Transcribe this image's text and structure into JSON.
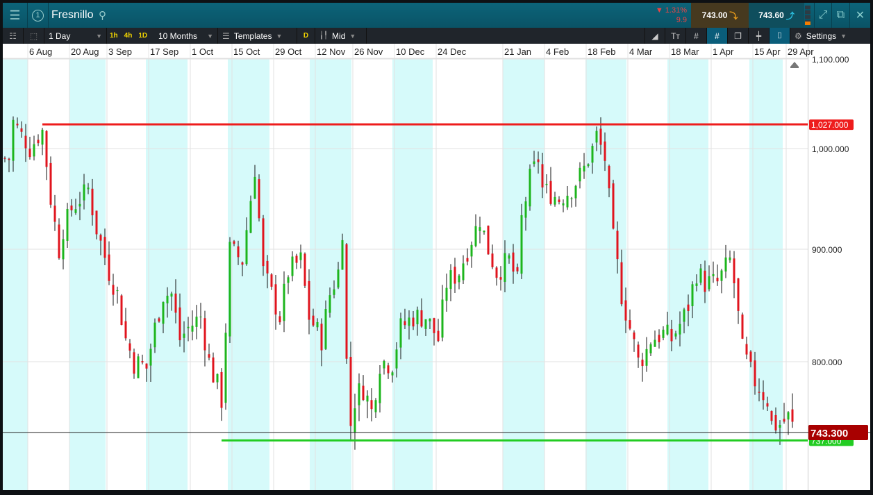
{
  "header": {
    "instrument": "Fresnillo",
    "change_pct": "1.31%",
    "change_abs": "9.9",
    "sell": "743.00",
    "buy": "743.60",
    "badge": "1"
  },
  "toolbar": {
    "interval": "1 Day",
    "quick": [
      "1h",
      "4h",
      "1D"
    ],
    "range": "10 Months",
    "templates": "Templates",
    "d": "D",
    "price_type": "Mid",
    "settings": "Settings"
  },
  "colors": {
    "up": "#1db51d",
    "down": "#e0141e",
    "resistance": "#ee1c1c",
    "support": "#22cc22"
  },
  "chart_data": {
    "type": "candlestick",
    "instrument": "Fresnillo",
    "x_tick_labels": [
      "6 Aug",
      "20 Aug",
      "3 Sep",
      "17 Sep",
      "1 Oct",
      "15 Oct",
      "29 Oct",
      "12 Nov",
      "26 Nov",
      "10 Dec",
      "24 Dec",
      "21 Jan",
      "4 Feb",
      "18 Feb",
      "4 Mar",
      "18 Mar",
      "1 Apr",
      "15 Apr",
      "29 Apr"
    ],
    "x_tick_day_index": [
      6,
      16,
      25,
      35,
      45,
      55,
      65,
      75,
      84,
      94,
      104,
      120,
      130,
      140,
      150,
      160,
      170,
      180,
      188
    ],
    "y_ticks": [
      {
        "v": 1100,
        "label": "1,100.000"
      },
      {
        "v": 1000,
        "label": "1,000.000"
      },
      {
        "v": 900,
        "label": "900.000"
      },
      {
        "v": 800,
        "label": "800.000"
      }
    ],
    "current_price": {
      "v": 743.3,
      "label": "743.300"
    },
    "horizontal_lines": [
      {
        "name": "resistance",
        "v": 1027,
        "label": "1,027.000",
        "from_day": 9
      },
      {
        "name": "support",
        "v": 737,
        "label": "737.000",
        "from_day": 52
      }
    ],
    "close_path": [
      [
        1,
        990
      ],
      [
        2,
        1030
      ],
      [
        6,
        1000
      ],
      [
        9,
        1020
      ],
      [
        11,
        950
      ],
      [
        13,
        900
      ],
      [
        14,
        920
      ],
      [
        16,
        940
      ],
      [
        20,
        960
      ],
      [
        22,
        920
      ],
      [
        25,
        880
      ],
      [
        27,
        860
      ],
      [
        29,
        820
      ],
      [
        31,
        800
      ],
      [
        34,
        795
      ],
      [
        36,
        830
      ],
      [
        38,
        860
      ],
      [
        40,
        860
      ],
      [
        42,
        820
      ],
      [
        44,
        830
      ],
      [
        47,
        840
      ],
      [
        49,
        800
      ],
      [
        52,
        770
      ],
      [
        53,
        830
      ],
      [
        54,
        900
      ],
      [
        57,
        890
      ],
      [
        60,
        980
      ],
      [
        62,
        880
      ],
      [
        64,
        860
      ],
      [
        66,
        840
      ],
      [
        68,
        880
      ],
      [
        71,
        890
      ],
      [
        73,
        840
      ],
      [
        76,
        820
      ],
      [
        78,
        860
      ],
      [
        80,
        880
      ],
      [
        81,
        920
      ],
      [
        82,
        800
      ],
      [
        83,
        750
      ],
      [
        84,
        770
      ],
      [
        86,
        780
      ],
      [
        88,
        760
      ],
      [
        90,
        800
      ],
      [
        93,
        800
      ],
      [
        95,
        830
      ],
      [
        98,
        840
      ],
      [
        101,
        840
      ],
      [
        104,
        820
      ],
      [
        106,
        870
      ],
      [
        109,
        880
      ],
      [
        112,
        910
      ],
      [
        114,
        930
      ],
      [
        116,
        900
      ],
      [
        118,
        880
      ],
      [
        121,
        890
      ],
      [
        123,
        870
      ],
      [
        124,
        930
      ],
      [
        126,
        970
      ],
      [
        128,
        990
      ],
      [
        129,
        960
      ],
      [
        133,
        950
      ],
      [
        136,
        960
      ],
      [
        139,
        980
      ],
      [
        141,
        1000
      ],
      [
        142,
        1015
      ],
      [
        144,
        990
      ],
      [
        146,
        910
      ],
      [
        148,
        860
      ],
      [
        150,
        830
      ],
      [
        152,
        800
      ],
      [
        154,
        810
      ],
      [
        155,
        820
      ],
      [
        158,
        825
      ],
      [
        160,
        820
      ],
      [
        163,
        840
      ],
      [
        164,
        850
      ],
      [
        166,
        880
      ],
      [
        168,
        870
      ],
      [
        171,
        870
      ],
      [
        174,
        890
      ],
      [
        175,
        870
      ],
      [
        177,
        810
      ],
      [
        179,
        790
      ],
      [
        181,
        780
      ],
      [
        183,
        770
      ],
      [
        184,
        750
      ],
      [
        186,
        750
      ],
      [
        188,
        755
      ],
      [
        189,
        748
      ]
    ]
  }
}
